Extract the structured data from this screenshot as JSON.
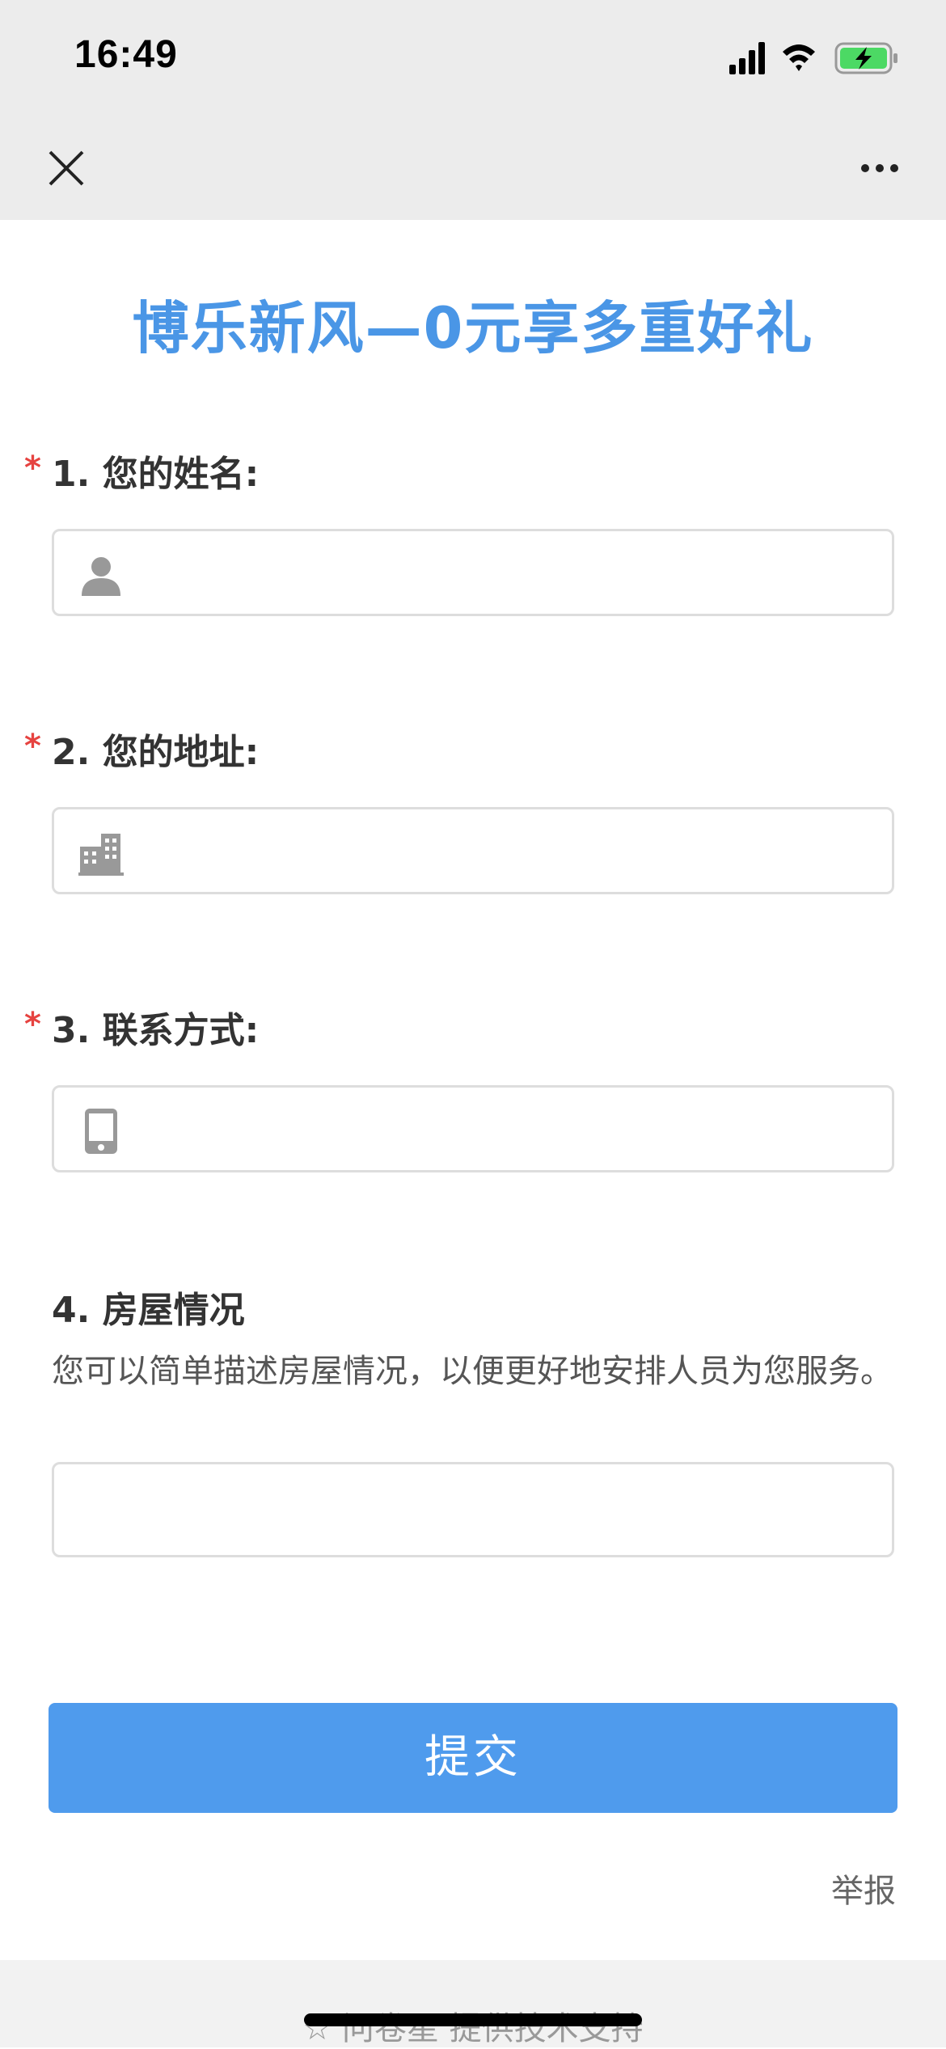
{
  "status_bar": {
    "time": "16:49",
    "icons": [
      "signal-icon",
      "wifi-icon",
      "battery-charging-icon"
    ]
  },
  "nav": {
    "close_icon": "close-icon",
    "more_icon": "more-icon"
  },
  "form": {
    "title": "博乐新风—0元享多重好礼",
    "questions": [
      {
        "required": true,
        "star": "*",
        "label": "1. 您的姓名:",
        "icon": "person-icon",
        "value": ""
      },
      {
        "required": true,
        "star": "*",
        "label": "2. 您的地址:",
        "icon": "building-icon",
        "value": ""
      },
      {
        "required": true,
        "star": "*",
        "label": "3. 联系方式:",
        "icon": "phone-icon",
        "value": ""
      },
      {
        "required": false,
        "label": "4. 房屋情况",
        "description": "您可以简单描述房屋情况，以便更好地安排人员为您服务。",
        "value": ""
      }
    ],
    "submit_label": "提交",
    "report_label": "举报"
  },
  "footer": {
    "text": "☆ 问卷星 提供技术支持"
  },
  "colors": {
    "title": "#4a96e6",
    "submit_bg": "#4f9bed",
    "required_star": "#e64340",
    "bar_bg": "#ececec",
    "battery": "#4cd964"
  }
}
